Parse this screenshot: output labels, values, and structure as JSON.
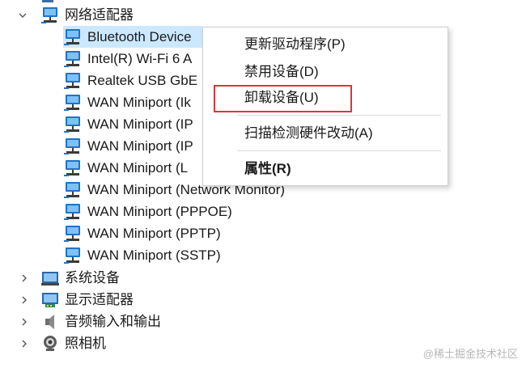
{
  "tree": {
    "network_adapters_label": "网络适配器",
    "adapters": [
      "Bluetooth Device",
      "Intel(R) Wi-Fi 6 A",
      "Realtek USB GbE",
      "WAN Miniport (Ik",
      "WAN Miniport (IP",
      "WAN Miniport (IP",
      "WAN Miniport (L",
      "WAN Miniport (Network Monitor)",
      "WAN Miniport (PPPOE)",
      "WAN Miniport (PPTP)",
      "WAN Miniport (SSTP)"
    ],
    "categories": [
      {
        "label": "系统设备",
        "icon": "system-devices-icon"
      },
      {
        "label": "显示适配器",
        "icon": "display-adapter-icon"
      },
      {
        "label": "音频输入和输出",
        "icon": "speaker-icon"
      },
      {
        "label": "照相机",
        "icon": "camera-icon"
      }
    ]
  },
  "context_menu": {
    "update_driver": "更新驱动程序(P)",
    "disable_device": "禁用设备(D)",
    "uninstall_device": "卸载设备(U)",
    "scan_hardware": "扫描检测硬件改动(A)",
    "properties": "属性(R)"
  },
  "watermark": "@稀土掘金技术社区",
  "colors": {
    "selection_bg": "#cce8ff",
    "highlight_border": "#d9363e",
    "network_icon_blue": "#1f73c8"
  }
}
